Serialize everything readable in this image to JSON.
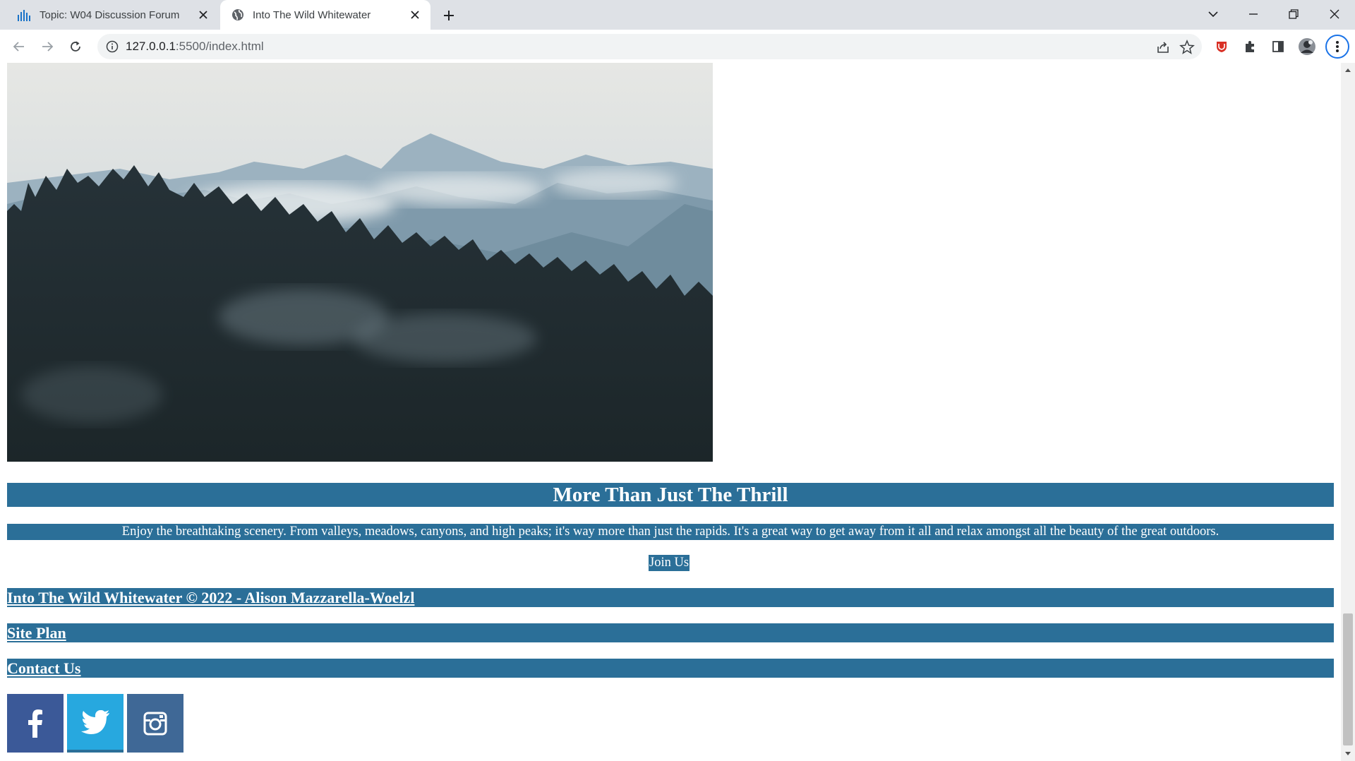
{
  "browser": {
    "tabs": [
      {
        "title": "Topic: W04 Discussion Forum",
        "icon": "bar-chart-icon",
        "active": false
      },
      {
        "title": "Into The Wild Whitewater",
        "icon": "globe-icon",
        "active": true
      }
    ],
    "url_host": "127.0.0.1",
    "url_rest": ":5500/index.html"
  },
  "page": {
    "section_heading": "More Than Just The Thrill",
    "section_text": "Enjoy the breathtaking scenery. From valleys, meadows, canyons, and high peaks; it's way more than just the rapids. It's a great way to get away from it all and relax amongst all the beauty of the great outdoors.",
    "join_link": "Join Us",
    "footer": {
      "copyright": "Into The Wild Whitewater © 2022 - Alison Mazzarella-Woelzl",
      "site_plan": "Site Plan",
      "contact": "Contact Us"
    },
    "social": [
      {
        "name": "facebook",
        "icon": "facebook-icon",
        "color": "#3b5998"
      },
      {
        "name": "twitter",
        "icon": "twitter-icon",
        "color": "#27a8df"
      },
      {
        "name": "instagram",
        "icon": "instagram-icon",
        "color": "#3f6896"
      }
    ],
    "accent_color": "#2b6f98"
  }
}
